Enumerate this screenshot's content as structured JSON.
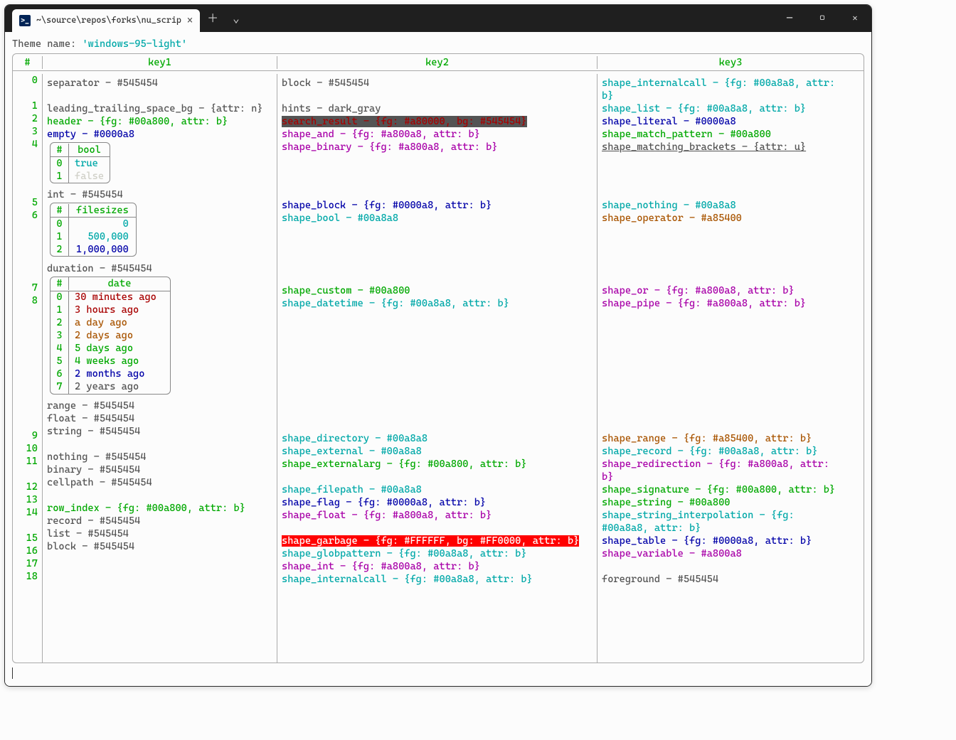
{
  "tab": {
    "title": "~\\source\\repos\\forks\\nu_scrip",
    "icon_glyph": ">_"
  },
  "theme_label": "Theme name:",
  "theme_value": "'windows-95-light'",
  "headers": {
    "num": "#",
    "k1": "key1",
    "k2": "key2",
    "k3": "key3"
  },
  "row_nums": [
    "0",
    "1",
    "2",
    "3",
    "4",
    "5",
    "6",
    "7",
    "8",
    "9",
    "10",
    "11",
    "12",
    "13",
    "14",
    "15",
    "16",
    "17",
    "18"
  ],
  "col1": {
    "r0": "separator - #545454",
    "r1": "leading_trailing_space_bg - {attr: n}",
    "r2": "header - {fg: #00a800, attr: b}",
    "r3": "empty - #0000a8",
    "r5": "int - #545454",
    "r7": "duration - #545454",
    "r9": "range - #545454",
    "r10": "float - #545454",
    "r11": "string - #545454",
    "r12": "nothing - #545454",
    "r13": "binary - #545454",
    "r14": "cellpath - #545454",
    "r15": "row_index - {fg: #00a800, attr: b}",
    "r16": "record - #545454",
    "r17": "list - #545454",
    "r18": "block - #545454"
  },
  "bool_table": {
    "hdr_num": "#",
    "hdr_key": "bool",
    "rows": [
      {
        "n": "0",
        "v": "true"
      },
      {
        "n": "1",
        "v": "false"
      }
    ]
  },
  "fs_table": {
    "hdr_num": "#",
    "hdr_key": "filesizes",
    "rows": [
      {
        "n": "0",
        "v": "0"
      },
      {
        "n": "1",
        "v": "500,000"
      },
      {
        "n": "2",
        "v": "1,000,000"
      }
    ]
  },
  "date_table": {
    "hdr_num": "#",
    "hdr_key": "date",
    "rows": [
      {
        "n": "0",
        "v": "30 minutes ago",
        "c": "c-red"
      },
      {
        "n": "1",
        "v": "3 hours ago",
        "c": "c-red"
      },
      {
        "n": "2",
        "v": "a day ago",
        "c": "c-yel"
      },
      {
        "n": "3",
        "v": "2 days ago",
        "c": "c-yel"
      },
      {
        "n": "4",
        "v": "5 days ago",
        "c": "c-green"
      },
      {
        "n": "5",
        "v": "4 weeks ago",
        "c": "c-green"
      },
      {
        "n": "6",
        "v": "2 months ago",
        "c": "c-blue"
      },
      {
        "n": "7",
        "v": "2 years ago",
        "c": "c-gray"
      }
    ]
  },
  "col2": {
    "r0": "block - #545454",
    "r1": "hints - dark_gray",
    "sr": "search_result - {fg: #a80000, bg: #545454}",
    "r3": "shape_and - {fg: #a800a8, attr: b}",
    "r4": "shape_binary - {fg: #a800a8, attr: b}",
    "r5": "shape_block - {fg: #0000a8, attr: b}",
    "r6": "shape_bool - #00a8a8",
    "r7": "shape_custom - #00a800",
    "r8": "shape_datetime - {fg: #00a8a8, attr: b}",
    "r9": "shape_directory - #00a8a8",
    "r10": "shape_external - #00a8a8",
    "r11": "shape_externalarg - {fg: #00a800, attr: b}",
    "r12": "shape_filepath - #00a8a8",
    "r13": "shape_flag - {fg: #0000a8, attr: b}",
    "r14": "shape_float - {fg: #a800a8, attr: b}",
    "g": "shape_garbage - {fg: #FFFFFF, bg: #FF0000, attr: b}",
    "r16": "shape_globpattern - {fg: #00a8a8, attr: b}",
    "r17": "shape_int - {fg: #a800a8, attr: b}",
    "r18": "shape_internalcall - {fg: #00a8a8, attr: b}"
  },
  "col3": {
    "r0a": "shape_internalcall - {fg: #00a8a8, attr:",
    "r0b": "b}",
    "r1": "shape_list - {fg: #00a8a8, attr: b}",
    "r2": "shape_literal - #0000a8",
    "r3": "shape_match_pattern - #00a800",
    "r4": "shape_matching_brackets - {attr: u}",
    "r5": "shape_nothing - #00a8a8",
    "r6": "shape_operator - #a85400",
    "r7": "shape_or - {fg: #a800a8, attr: b}",
    "r8": "shape_pipe - {fg: #a800a8, attr: b}",
    "r9": "shape_range - {fg: #a85400, attr: b}",
    "r10": "shape_record - {fg: #00a8a8, attr: b}",
    "r11a": "shape_redirection - {fg: #a800a8, attr:",
    "r11b": "b}",
    "r12": "shape_signature - {fg: #00a800, attr: b}",
    "r13": "shape_string - #00a800",
    "r14a": "shape_string_interpolation - {fg:",
    "r14b": "#00a8a8, attr: b}",
    "r15": "shape_table - {fg: #0000a8, attr: b}",
    "r16": "shape_variable - #a800a8",
    "r18": "foreground - #545454"
  }
}
